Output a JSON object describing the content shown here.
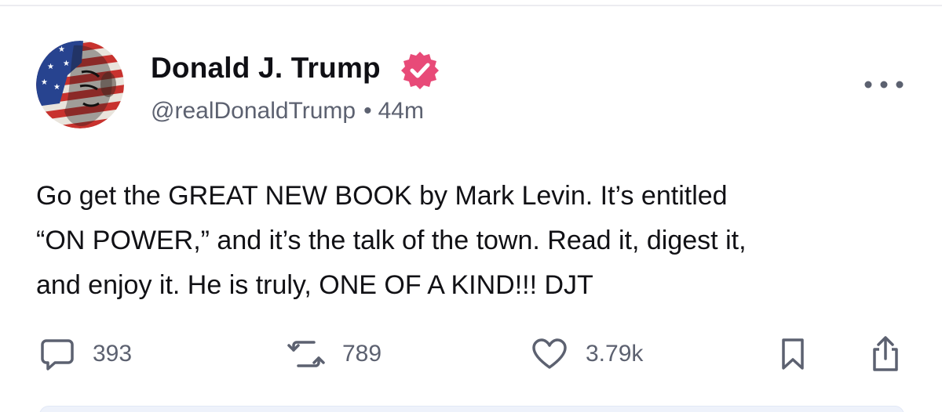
{
  "post": {
    "author_name": "Donald J. Trump",
    "handle": "@realDonaldTrump",
    "separator": "•",
    "time_ago": "44m",
    "body_lines": [
      "Go get the GREAT NEW BOOK by Mark Levin. It’s entitled",
      "“ON POWER,” and it’s the talk of the town. Read it, digest it,",
      "and enjoy it. He is truly, ONE OF A KIND!!! DJT"
    ]
  },
  "actions": {
    "replies": {
      "icon": "comment-icon",
      "count": "393"
    },
    "reposts": {
      "icon": "repost-icon",
      "count": "789"
    },
    "likes": {
      "icon": "heart-icon",
      "count": "3.79k"
    },
    "bookmark": {
      "icon": "bookmark-icon"
    },
    "share": {
      "icon": "share-icon"
    }
  },
  "colors": {
    "verified_badge": "#e84a78",
    "text_primary": "#0f0f14",
    "text_secondary": "#5c6170",
    "icon": "#5c6170"
  }
}
